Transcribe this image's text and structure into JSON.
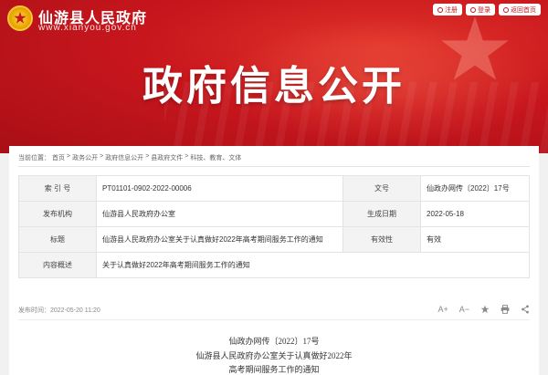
{
  "header": {
    "site_title": "仙游县人民政府",
    "site_url": "www.xianyou.gov.cn",
    "hero_title": "政府信息公开",
    "buttons": {
      "register": "注册",
      "login": "登录",
      "home": "返回首页"
    }
  },
  "breadcrumb": {
    "prefix": "当前位置：",
    "items": [
      "首页",
      "政务公开",
      "政府信息公开",
      "县政府文件",
      "科技、教育、文体"
    ],
    "separator": ">"
  },
  "meta_table": {
    "rows": [
      {
        "k1": "索 引 号",
        "v1": "PT01101-0902-2022-00006",
        "k2": "文号",
        "v2": "仙政办网传〔2022〕17号"
      },
      {
        "k1": "发布机构",
        "v1": "仙游县人民政府办公室",
        "k2": "生成日期",
        "v2": "2022-05-18"
      },
      {
        "k1": "标题",
        "v1": "仙游县人民政府办公室关于认真做好2022年高考期间服务工作的通知",
        "k2": "有效性",
        "v2": "有效"
      },
      {
        "k1": "内容概述",
        "v1": "关于认真做好2022年高考期间服务工作的通知"
      }
    ]
  },
  "publish": {
    "label": "发布时间：",
    "time": "2022-05-20 11:20"
  },
  "tools": {
    "font_up": "A+",
    "font_down": "A−"
  },
  "document": {
    "line1": "仙政办网传〔2022〕17号",
    "line2": "仙游县人民政府办公室关于认真做好2022年",
    "line3": "高考期间服务工作的通知"
  }
}
